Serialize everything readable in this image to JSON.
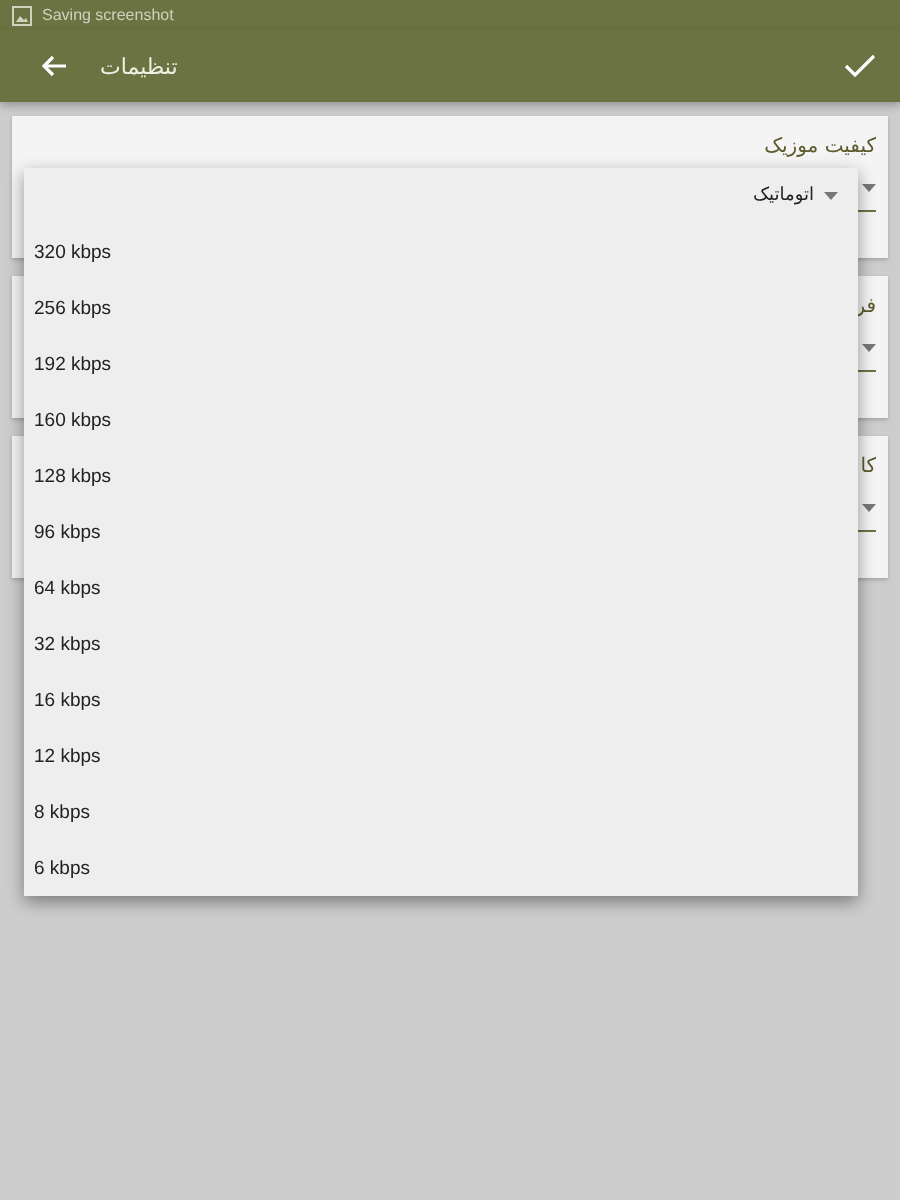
{
  "status_bar": {
    "text": "Saving screenshot"
  },
  "app_bar": {
    "title": "تنظیمات"
  },
  "settings": [
    {
      "label": "کیفیت موزیک"
    },
    {
      "label": "فر"
    },
    {
      "label": "کا"
    }
  ],
  "menu": {
    "items": [
      {
        "kind": "current",
        "label": "اتوماتیک"
      },
      {
        "kind": "option",
        "label": "320 kbps"
      },
      {
        "kind": "option",
        "label": "256 kbps"
      },
      {
        "kind": "option",
        "label": "192 kbps"
      },
      {
        "kind": "option",
        "label": "160 kbps"
      },
      {
        "kind": "option",
        "label": "128 kbps"
      },
      {
        "kind": "option",
        "label": "96 kbps"
      },
      {
        "kind": "option",
        "label": "64 kbps"
      },
      {
        "kind": "option",
        "label": "32 kbps"
      },
      {
        "kind": "option",
        "label": "16 kbps"
      },
      {
        "kind": "option",
        "label": "12 kbps"
      },
      {
        "kind": "option",
        "label": "8 kbps"
      },
      {
        "kind": "option",
        "label": "6 kbps"
      }
    ]
  }
}
